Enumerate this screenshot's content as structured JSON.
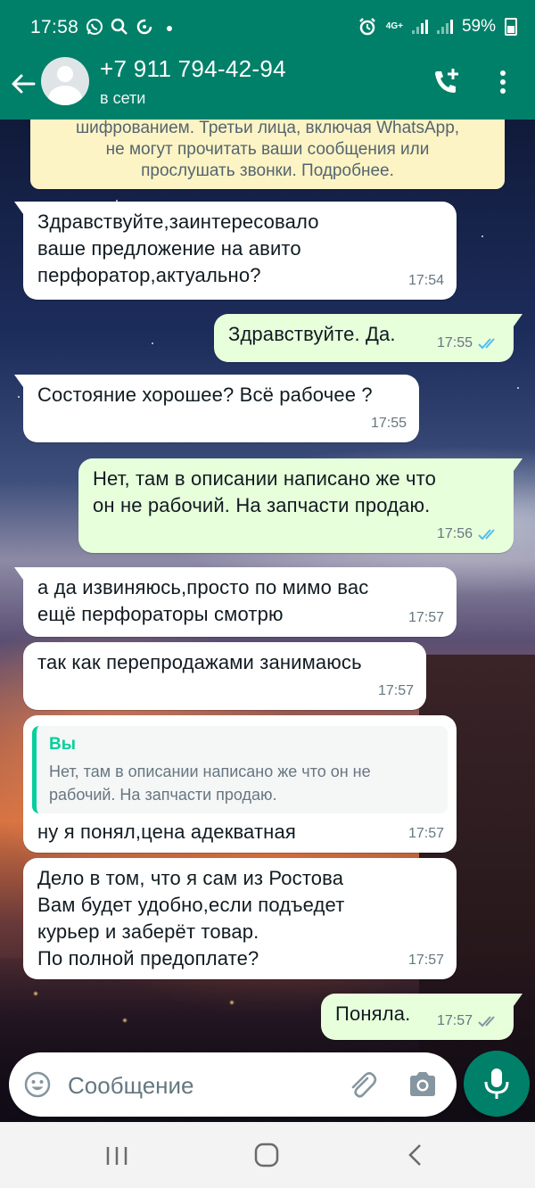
{
  "status_bar": {
    "time": "17:58",
    "network": "4G+",
    "battery": "59%",
    "icons_left": [
      "whatsapp-icon",
      "search-icon",
      "data-saver-icon",
      "dot-icon"
    ],
    "icons_right": [
      "alarm-icon",
      "network-4g-icon",
      "signal-icon",
      "signal-icon",
      "battery-icon"
    ]
  },
  "header": {
    "contact_name": "+7 911 794-42-94",
    "contact_status": "в сети",
    "brand_color": "#008069"
  },
  "encryption_notice": {
    "text": "шифрованием. Третьи лица, включая WhatsApp,\nне могут прочитать ваши сообщения или\nпрослушать звонки. Подробнее."
  },
  "messages": [
    {
      "direction": "in",
      "text": "Здравствуйте,заинтересовало\nваше предложение на авито\nперфоратор,актуально?",
      "time": "17:54"
    },
    {
      "direction": "out",
      "text": "Здравствуйте. Да.",
      "time": "17:55",
      "status": "read"
    },
    {
      "direction": "in",
      "text": "Состояние хорошее? Всё рабочее ?",
      "time": "17:55"
    },
    {
      "direction": "out",
      "text": "Нет, там в описании написано же что\nон не рабочий. На запчасти продаю.",
      "time": "17:56",
      "status": "read"
    },
    {
      "direction": "in",
      "text": "а да извиняюсь,просто по мимо вас\nещё перфораторы смотрю",
      "time": "17:57"
    },
    {
      "direction": "in",
      "text": "так как перепродажами занимаюсь",
      "time": "17:57"
    },
    {
      "direction": "in",
      "text": "ну я понял,цена адекватная",
      "time": "17:57",
      "reply": {
        "author": "Вы",
        "text": "Нет, там в описании написано же что он не\nрабочий. На запчасти продаю."
      }
    },
    {
      "direction": "in",
      "text": "Дело в том, что я сам из Ростова\nВам будет удобно,если подъедет\nкурьер и заберёт товар.\nПо полной предоплате?",
      "time": "17:57"
    },
    {
      "direction": "out",
      "text": "Поняла.",
      "time": "17:57",
      "status": "delivered"
    }
  ],
  "composer": {
    "placeholder": "Сообщение"
  },
  "colors": {
    "incoming_bubble": "#ffffff",
    "outgoing_bubble": "#e7ffdb",
    "read_ticks": "#53bdeb",
    "delivered_ticks": "#8696a0",
    "accent": "#008069"
  }
}
